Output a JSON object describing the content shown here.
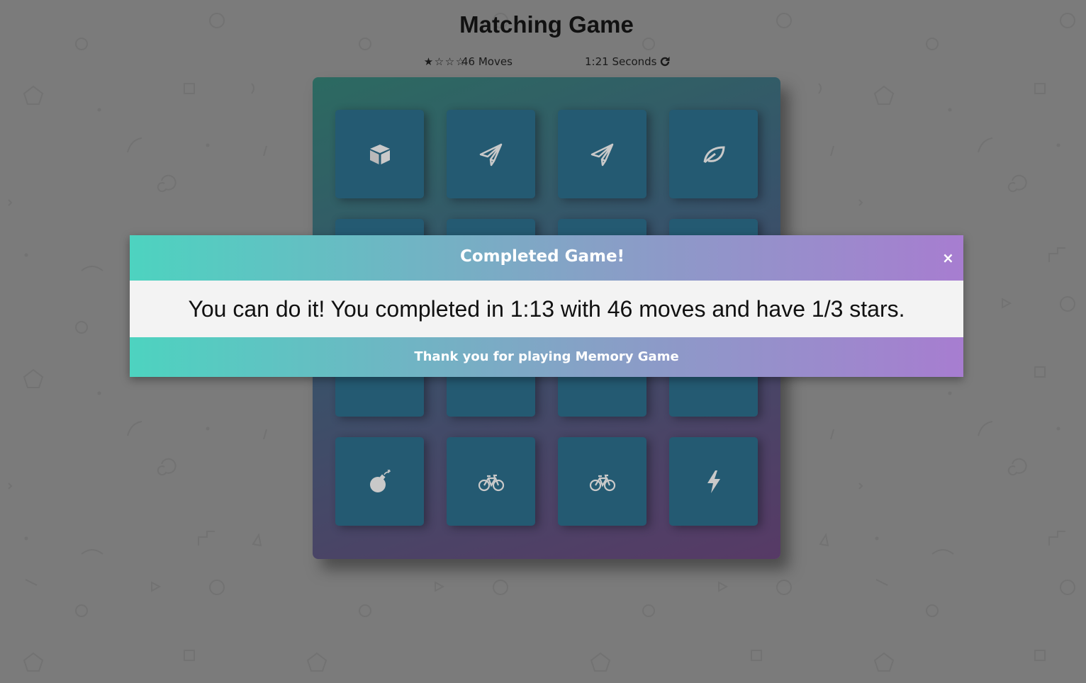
{
  "page": {
    "title": "Matching Game"
  },
  "score_panel": {
    "stars": [
      "★",
      "☆",
      "☆",
      "☆"
    ],
    "moves_label": "46 Moves",
    "timer_label": "1:21 Seconds",
    "restart_icon": "redo-icon"
  },
  "deck": {
    "cards": [
      {
        "icon": "cube-icon"
      },
      {
        "icon": "paper-plane-icon"
      },
      {
        "icon": "paper-plane-icon"
      },
      {
        "icon": "leaf-icon"
      },
      {
        "icon": "hidden"
      },
      {
        "icon": "hidden"
      },
      {
        "icon": "hidden"
      },
      {
        "icon": "hidden"
      },
      {
        "icon": "hidden"
      },
      {
        "icon": "hidden"
      },
      {
        "icon": "hidden"
      },
      {
        "icon": "hidden"
      },
      {
        "icon": "bomb-icon"
      },
      {
        "icon": "bicycle-icon"
      },
      {
        "icon": "bicycle-icon"
      },
      {
        "icon": "bolt-icon"
      }
    ]
  },
  "modal": {
    "title": "Completed Game!",
    "close_label": "×",
    "message": "You can do it! You completed in 1:13 with 46 moves and have 1/3 stars.",
    "footer": "Thank you for playing Memory Game"
  },
  "colors": {
    "background": "#7b7b7b",
    "card": "#245a72",
    "gradient_start": "#4dd3c0",
    "gradient_end": "#a77dd0"
  }
}
